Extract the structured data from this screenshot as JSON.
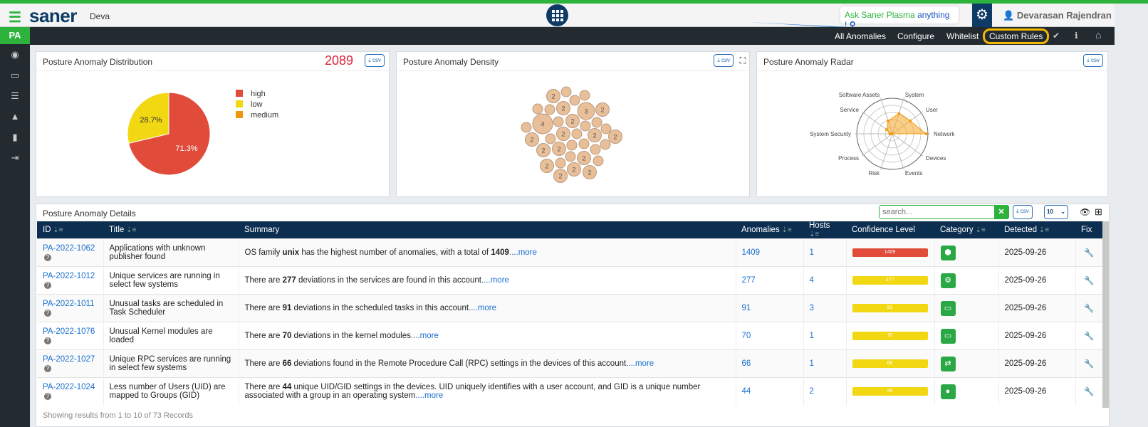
{
  "header": {
    "logo": "saner",
    "account": "Deva",
    "ask_green": "Ask Saner Plasma",
    "ask_blue": "anything !",
    "user": "Devarasan Rajendran"
  },
  "nav": {
    "items": [
      "All Anomalies",
      "Configure",
      "Whitelist",
      "Custom Rules"
    ]
  },
  "sidebar": {
    "badge": "PA"
  },
  "distribution": {
    "title": "Posture Anomaly Distribution",
    "total": "2089",
    "csv": "csv"
  },
  "density": {
    "title": "Posture Anomaly Density",
    "csv": "csv"
  },
  "radar": {
    "title": "Posture Anomaly Radar",
    "csv": "csv"
  },
  "details": {
    "title": "Posture Anomaly Details",
    "search_placeholder": "search...",
    "csv": "csv",
    "page_size": "10",
    "footer": "Showing results from 1 to 10 of 73 Records"
  },
  "columns": [
    "ID",
    "Title",
    "Summary",
    "Anomalies",
    "Hosts",
    "Confidence Level",
    "Category",
    "Detected",
    "Fix"
  ],
  "rows": [
    {
      "id": "PA-2022-1062",
      "title": "Applications with unknown publisher found",
      "s1": "OS family ",
      "b1": "unix",
      "s2": " has the highest number of anomalies, with a total of ",
      "b2": "1409",
      "s3": "",
      "more": "....more",
      "anomalies": "1409",
      "hosts": "1",
      "conf": "1409",
      "conf_color": "#e04b3a",
      "cat_icon": "boxes-icon",
      "cat": "⬢",
      "detected": "2025-09-26"
    },
    {
      "id": "PA-2022-1012",
      "title": "Unique services are running in select few systems",
      "s1": "There are ",
      "b1": "277",
      "s2": " deviations in the services are found in this account",
      "b2": "",
      "s3": "",
      "more": "....more",
      "anomalies": "277",
      "hosts": "4",
      "conf": "277",
      "conf_color": "#f2d813",
      "cat_icon": "gears-icon",
      "cat": "⚙",
      "detected": "2025-09-26"
    },
    {
      "id": "PA-2022-1011",
      "title": "Unusual tasks are scheduled in Task Scheduler",
      "s1": "There are ",
      "b1": "91",
      "s2": " deviations in the scheduled tasks in this account",
      "b2": "",
      "s3": "",
      "more": "....more",
      "anomalies": "91",
      "hosts": "3",
      "conf": "91",
      "conf_color": "#f2d813",
      "cat_icon": "monitor-icon",
      "cat": "▭",
      "detected": "2025-09-26"
    },
    {
      "id": "PA-2022-1076",
      "title": "Unusual Kernel modules are loaded",
      "s1": "There are ",
      "b1": "70",
      "s2": " deviations in the kernel modules",
      "b2": "",
      "s3": "",
      "more": "....more",
      "anomalies": "70",
      "hosts": "1",
      "conf": "70",
      "conf_color": "#f2d813",
      "cat_icon": "monitor-icon",
      "cat": "▭",
      "detected": "2025-09-26"
    },
    {
      "id": "PA-2022-1027",
      "title": "Unique RPC services are running in select few systems",
      "s1": "There are ",
      "b1": "66",
      "s2": " deviations found in the Remote Procedure Call (RPC) settings in the devices of this account",
      "b2": "",
      "s3": "",
      "more": "....more",
      "anomalies": "66",
      "hosts": "1",
      "conf": "66",
      "conf_color": "#f2d813",
      "cat_icon": "exchange-icon",
      "cat": "⇄",
      "detected": "2025-09-26"
    },
    {
      "id": "PA-2022-1024",
      "title": "Less number of Users (UID) are mapped to Groups (GID)",
      "s1": "There are ",
      "b1": "44",
      "s2": " unique UID/GID settings in the devices. UID uniquely identifies with a user account, and GID is a unique number associated with a group in an operating system",
      "b2": "",
      "s3": "",
      "more": "....more",
      "anomalies": "44",
      "hosts": "2",
      "conf": "44",
      "conf_color": "#f2d813",
      "cat_icon": "user-circle-icon",
      "cat": "●",
      "detected": "2025-09-26"
    }
  ],
  "chart_data": [
    {
      "type": "pie",
      "title": "Posture Anomaly Distribution",
      "legend_position": "right",
      "labels": [
        "high",
        "low",
        "medium"
      ],
      "values": [
        71.3,
        28.7,
        0
      ],
      "value_labels": [
        "71.3%",
        "28.7%",
        ""
      ],
      "colors": [
        "#e04b3a",
        "#f2d813",
        "#f0960e"
      ]
    },
    {
      "type": "bubble",
      "title": "Posture Anomaly Density",
      "values": [
        2,
        1,
        1,
        1,
        1,
        1,
        2,
        3,
        2,
        4,
        1,
        2,
        1,
        1,
        1,
        1,
        2,
        1,
        2,
        2,
        2,
        1,
        1,
        1,
        1,
        2,
        2,
        1,
        1,
        2,
        1,
        2,
        1,
        2,
        2,
        2
      ],
      "color": "#e8bf98"
    },
    {
      "type": "radar",
      "title": "Posture Anomaly Radar",
      "axes": [
        "Network",
        "User",
        "System",
        "Software Assets",
        "Service",
        "System Security",
        "Process",
        "Risk",
        "Events",
        "Devices"
      ],
      "values": [
        0.95,
        0.62,
        0.6,
        0.38,
        0.2,
        0.07,
        0,
        0,
        0,
        0
      ],
      "range": [
        0,
        1
      ],
      "color": "#f5a623"
    }
  ]
}
